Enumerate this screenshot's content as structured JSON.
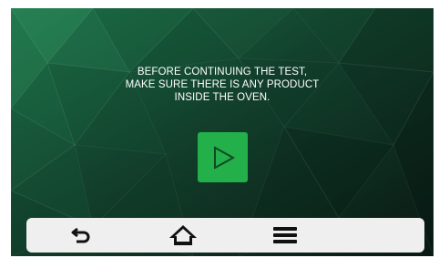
{
  "message": {
    "line1": "BEFORE CONTINUING THE TEST,",
    "line2": "MAKE SURE THERE IS ANY PRODUCT",
    "line3": "INSIDE THE OVEN."
  },
  "play_button": {
    "icon": "play-icon",
    "color": "#23b04a"
  },
  "nav_bar": {
    "items": [
      {
        "icon": "back-icon"
      },
      {
        "icon": "home-icon"
      },
      {
        "icon": "menu-icon"
      }
    ],
    "background": "#efefef"
  },
  "theme": {
    "background_dark": "#0d1f17",
    "background_green": "#1f5a3a",
    "text_color": "#ffffff"
  }
}
